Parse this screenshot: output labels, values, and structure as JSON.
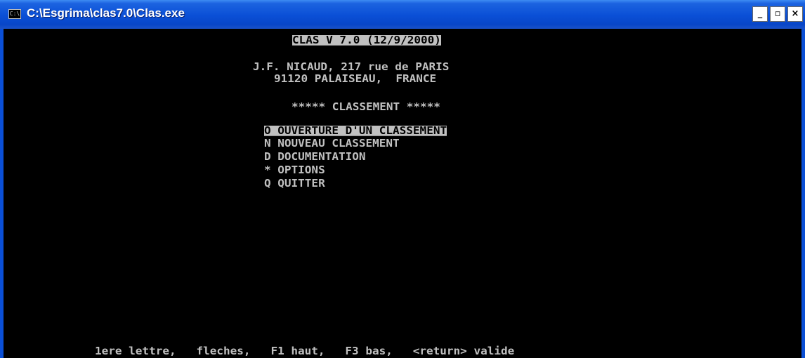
{
  "window": {
    "title": "C:\\Esgrima\\clas7.0\\Clas.exe",
    "icon_text": "C:\\",
    "controls": {
      "minimize": "_",
      "maximize": "▫",
      "close": "×"
    }
  },
  "console": {
    "header": "CLAS V 7.0 (12/9/2000)",
    "address_line1": "J.F. NICAUD, 217 rue de PARIS",
    "address_line2": "91120 PALAISEAU,  FRANCE",
    "section_title": "***** CLASSEMENT *****",
    "menu": [
      {
        "text": "O OUVERTURE D'UN CLASSEMENT",
        "selected": true
      },
      {
        "text": "N NOUVEAU CLASSEMENT",
        "selected": false
      },
      {
        "text": "D DOCUMENTATION",
        "selected": false
      },
      {
        "text": "* OPTIONS",
        "selected": false
      },
      {
        "text": "Q QUITTER",
        "selected": false
      }
    ],
    "help_line": "1ere lettre,   fleches,   F1 haut,   F3 bas,   <return> valide"
  },
  "colors": {
    "console_bg": "#000000",
    "console_fg": "#c0c0c0",
    "titlebar": "#0a4fd6"
  }
}
